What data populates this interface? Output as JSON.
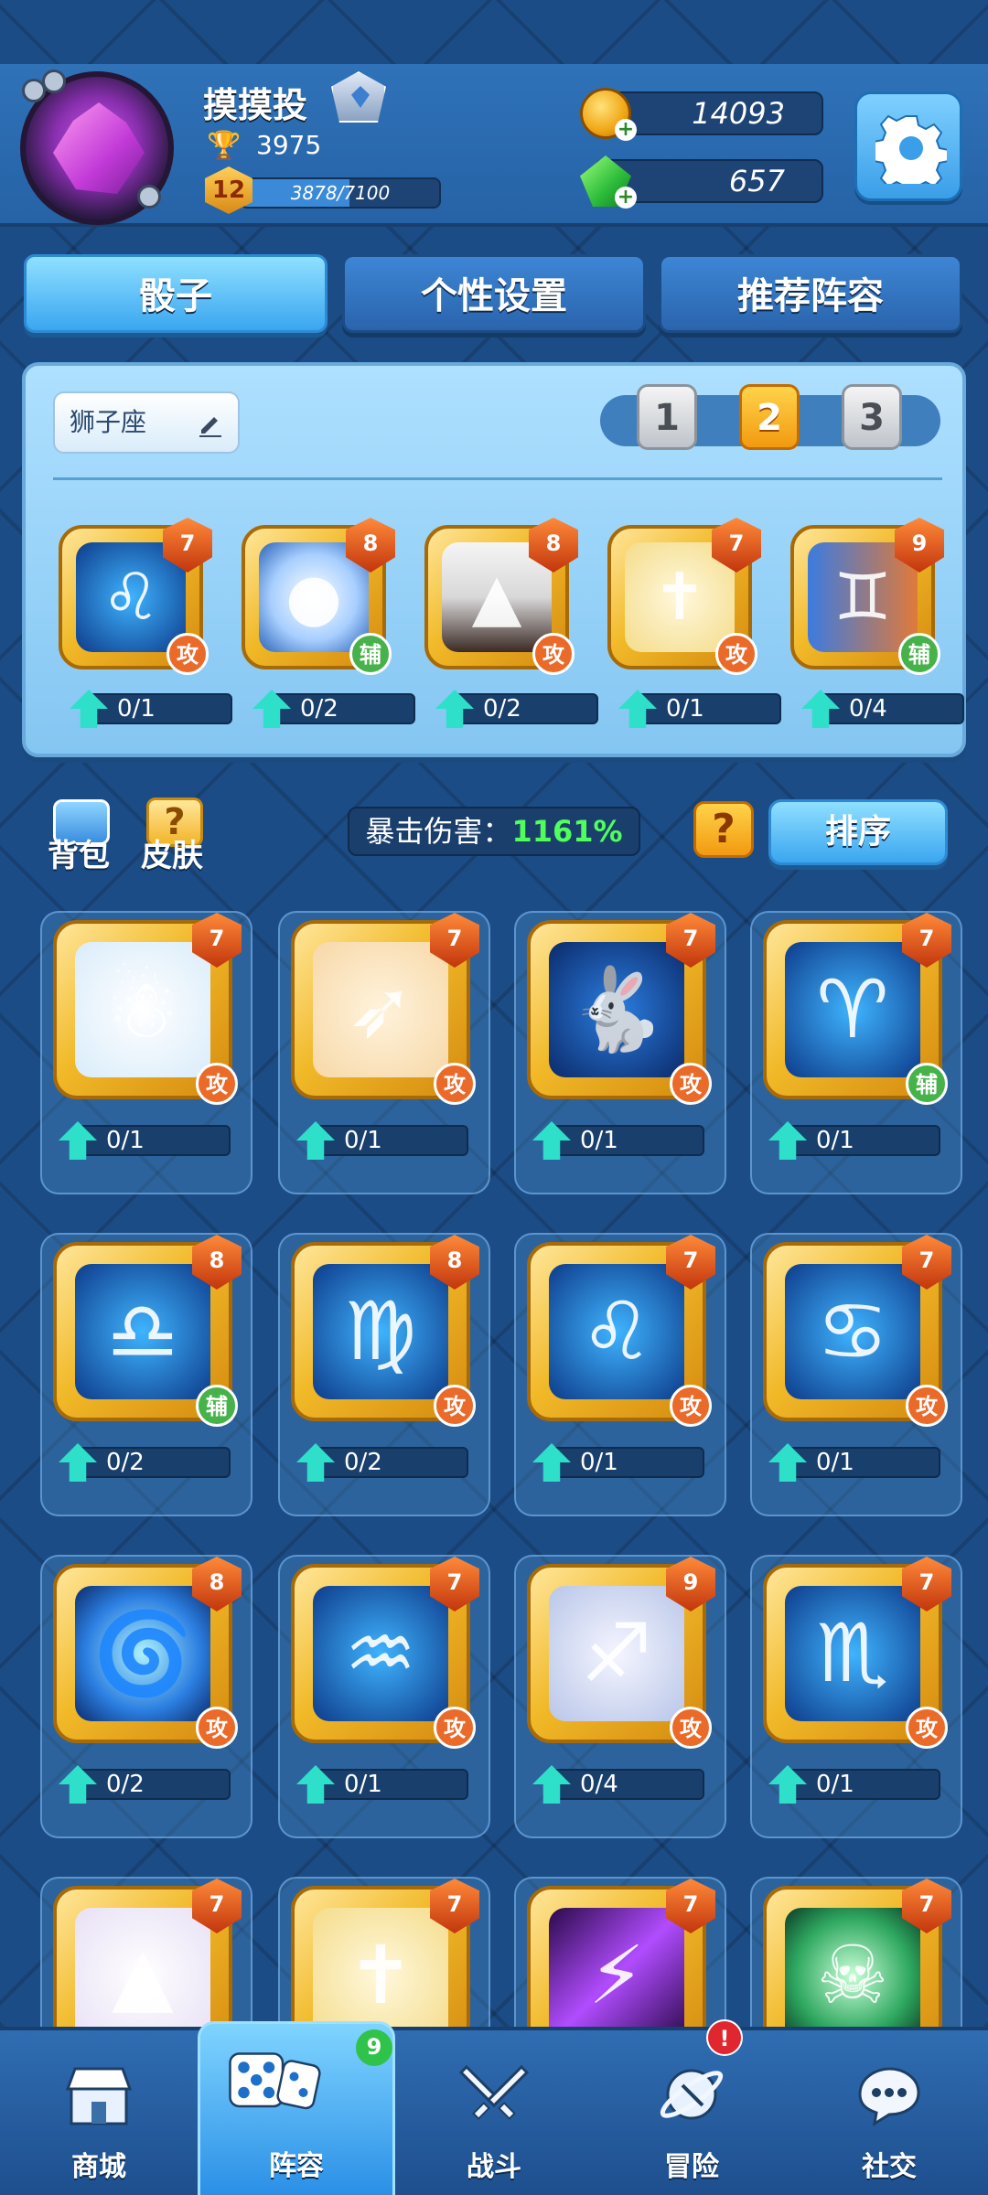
{
  "player": {
    "name": "摸摸投",
    "trophies": "3975",
    "level": "12",
    "xp_text": "3878/7100",
    "xp_fraction": 0.546
  },
  "currency": {
    "coins": "14093",
    "gems": "657"
  },
  "tabs": [
    {
      "label": "骰子"
    },
    {
      "label": "个性设置"
    },
    {
      "label": "推荐阵容"
    }
  ],
  "deck": {
    "name": "狮子座",
    "slots": [
      "1",
      "2",
      "3"
    ],
    "active_slot": 2,
    "cards": [
      {
        "icon": "leo-icon",
        "level": "7",
        "type": "攻",
        "progress": "0/1"
      },
      {
        "icon": "moon-icon",
        "level": "8",
        "type": "辅",
        "progress": "0/2"
      },
      {
        "icon": "volcano-icon",
        "level": "8",
        "type": "攻",
        "progress": "0/2"
      },
      {
        "icon": "holy-cross-icon",
        "level": "7",
        "type": "攻",
        "progress": "0/1"
      },
      {
        "icon": "gemini-icon",
        "level": "9",
        "type": "辅",
        "progress": "0/4"
      }
    ]
  },
  "utility": {
    "bag_label": "背包",
    "skin_label": "皮肤",
    "crit_label": "暴击伤害：",
    "crit_value": "1161%",
    "help": "?",
    "sort_label": "排序"
  },
  "collection": [
    {
      "icon": "snowman-icon",
      "level": "7",
      "type": "攻",
      "progress": "0/1"
    },
    {
      "icon": "archer-bow-icon",
      "level": "7",
      "type": "攻",
      "progress": "0/1"
    },
    {
      "icon": "rabbit-icon",
      "level": "7",
      "type": "攻",
      "progress": "0/1"
    },
    {
      "icon": "aries-icon",
      "level": "7",
      "type": "辅",
      "progress": "0/1"
    },
    {
      "icon": "libra-icon",
      "level": "8",
      "type": "辅",
      "progress": "0/2"
    },
    {
      "icon": "virgo-icon",
      "level": "8",
      "type": "攻",
      "progress": "0/2"
    },
    {
      "icon": "leo-icon",
      "level": "7",
      "type": "攻",
      "progress": "0/1"
    },
    {
      "icon": "cancer-icon",
      "level": "7",
      "type": "攻",
      "progress": "0/1"
    },
    {
      "icon": "wind-vortex-icon",
      "level": "8",
      "type": "攻",
      "progress": "0/2"
    },
    {
      "icon": "aquarius-icon",
      "level": "7",
      "type": "攻",
      "progress": "0/1"
    },
    {
      "icon": "sagittarius-icon",
      "level": "9",
      "type": "攻",
      "progress": "0/4"
    },
    {
      "icon": "scorpio-icon",
      "level": "7",
      "type": "攻",
      "progress": "0/1"
    },
    {
      "icon": "witch-hat-icon",
      "level": "7",
      "type": "",
      "progress": ""
    },
    {
      "icon": "holy-cross-icon",
      "level": "7",
      "type": "",
      "progress": ""
    },
    {
      "icon": "purple-slash-icon",
      "level": "7",
      "type": "",
      "progress": ""
    },
    {
      "icon": "green-ghost-icon",
      "level": "7",
      "type": "",
      "progress": ""
    }
  ],
  "nav": [
    {
      "label": "商城",
      "icon": "shop-icon"
    },
    {
      "label": "阵容",
      "icon": "dice-icon",
      "badge": "9"
    },
    {
      "label": "战斗",
      "icon": "crossed-swords-icon"
    },
    {
      "label": "冒险",
      "icon": "planet-icon",
      "badge": "!"
    },
    {
      "label": "社交",
      "icon": "chat-icon"
    }
  ],
  "colors": {
    "accent": "#3aa6f0",
    "gold": "#f1b928",
    "attack": "#ea6a2a",
    "support": "#47b24a",
    "crit": "#4fff5a"
  }
}
